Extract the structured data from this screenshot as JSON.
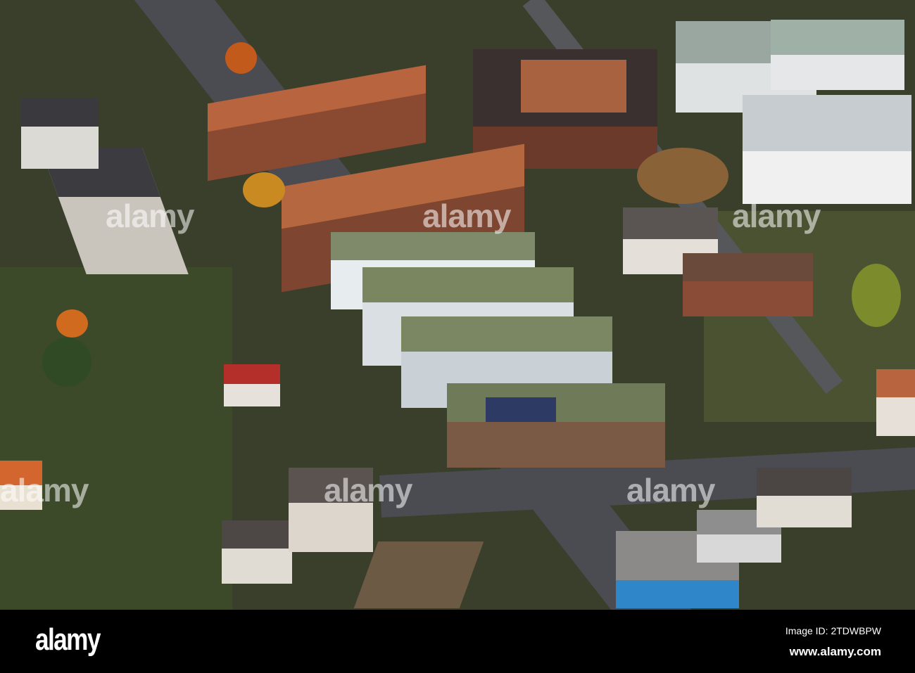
{
  "photo": {
    "description_label": "aerial-city-view",
    "watermark": "alamy"
  },
  "footer": {
    "logo": "alamy",
    "image_id": "Image ID: 2TDWBPW",
    "url": "www.alamy.com"
  }
}
